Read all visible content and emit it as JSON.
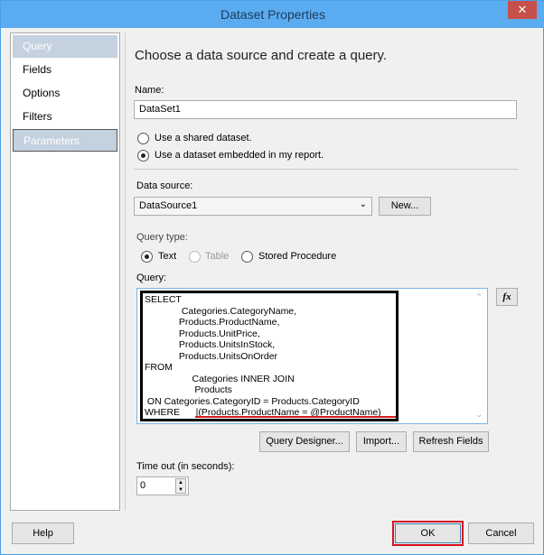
{
  "window": {
    "title": "Dataset Properties",
    "close": "✕"
  },
  "nav": {
    "items": [
      {
        "label": "Query"
      },
      {
        "label": "Fields"
      },
      {
        "label": "Options"
      },
      {
        "label": "Filters"
      },
      {
        "label": "Parameters"
      }
    ]
  },
  "main": {
    "heading": "Choose a data source and create a query.",
    "name_label": "Name:",
    "name_value": "DataSet1",
    "radio_shared": "Use a shared dataset.",
    "radio_embedded": "Use a dataset embedded in my report.",
    "datasource_label": "Data source:",
    "datasource_value": "DataSource1",
    "new_button": "New...",
    "querytype_label": "Query type:",
    "qt_text": "Text",
    "qt_table": "Table",
    "qt_sp": "Stored Procedure",
    "query_label": "Query:",
    "query_text": "SELECT\n              Categories.CategoryName,\n             Products.ProductName,\n             Products.UnitPrice,\n             Products.UnitsInStock,\n             Products.UnitsOnOrder\nFROM\n                  Categories INNER JOIN\n                   Products\n ON Categories.CategoryID = Products.CategoryID\nWHERE      |(Products.ProductName = @ProductName)",
    "fx_button": "fx",
    "query_designer": "Query Designer...",
    "import": "Import...",
    "refresh": "Refresh Fields",
    "timeout_label": "Time out (in seconds):",
    "timeout_value": "0"
  },
  "footer": {
    "help": "Help",
    "ok": "OK",
    "cancel": "Cancel"
  }
}
